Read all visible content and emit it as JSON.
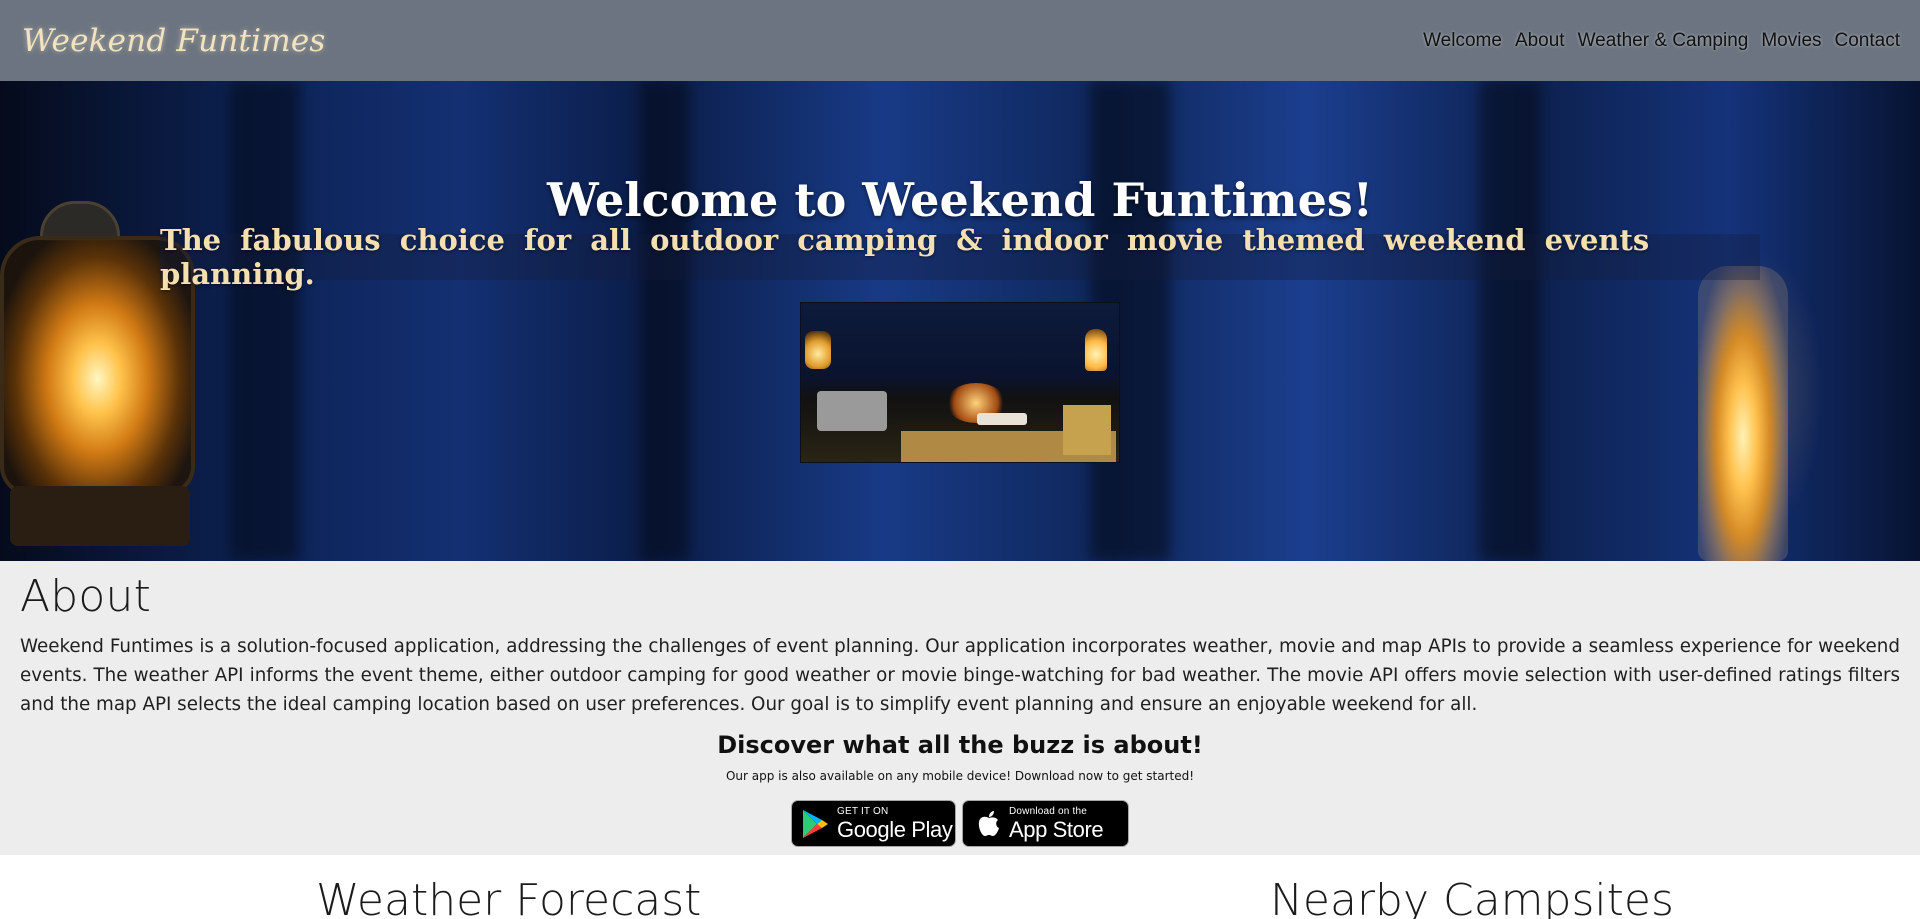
{
  "brand": "Weekend Funtimes",
  "nav": {
    "items": [
      {
        "label": "Welcome"
      },
      {
        "label": "About"
      },
      {
        "label": "Weather & Camping"
      },
      {
        "label": "Movies"
      },
      {
        "label": "Contact"
      }
    ]
  },
  "hero": {
    "title": "Welcome to Weekend Funtimes!",
    "tagline": "The fabulous choice for all outdoor camping & indoor movie themed weekend events planning."
  },
  "about": {
    "heading": "About",
    "text": "Weekend Funtimes is a solution-focused application, addressing the challenges of event planning. Our application incorporates weather, movie and map APIs to provide a seamless experience for weekend events. The weather API informs the event theme, either outdoor camping for good weather or movie binge-watching for bad weather. The movie API offers movie selection with user-defined ratings filters and the map API selects the ideal camping location based on user preferences. Our goal is to simplify event planning and ensure an enjoyable weekend for all.",
    "buzz_heading": "Discover what all the buzz is about!",
    "buzz_sub": "Our app is also available on any mobile device! Download now to get started!",
    "google_play": {
      "small": "GET IT ON",
      "big": "Google Play"
    },
    "app_store": {
      "small": "Download on the",
      "big": "App Store"
    }
  },
  "sections": {
    "weather_heading": "Weather Forecast",
    "campsites_heading": "Nearby Campsites"
  },
  "colors": {
    "navbar_bg": "#6b7480",
    "brand_text": "#f2e2bf",
    "tagline_text": "#f4dfb0",
    "about_bg": "#ededed"
  }
}
